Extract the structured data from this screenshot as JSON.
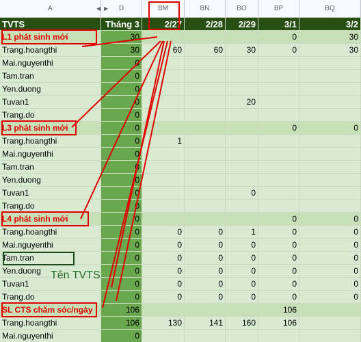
{
  "col_headers": [
    "A",
    "D",
    "BM",
    "BN",
    "BO",
    "BP",
    "BQ"
  ],
  "header_row": [
    "TVTS",
    "Tháng 3",
    "2/27",
    "2/28",
    "2/29",
    "3/1",
    "3/2"
  ],
  "rows": [
    {
      "type": "section",
      "cells": [
        "L1 phát sinh mới",
        "30",
        "",
        "",
        "",
        "0",
        "30"
      ]
    },
    {
      "type": "row",
      "cells": [
        "Trang.hoangthi",
        "30",
        "60",
        "60",
        "30",
        "0",
        "30"
      ]
    },
    {
      "type": "row",
      "cells": [
        "Mai.nguyenthi",
        "0",
        "",
        "",
        "",
        "",
        ""
      ]
    },
    {
      "type": "row",
      "cells": [
        "Tam.tran",
        "0",
        "",
        "",
        "",
        "",
        ""
      ]
    },
    {
      "type": "row",
      "cells": [
        "Yen.duong",
        "0",
        "",
        "",
        "",
        "",
        ""
      ]
    },
    {
      "type": "row",
      "cells": [
        "Tuvan1",
        "0",
        "",
        "",
        "20",
        "",
        ""
      ]
    },
    {
      "type": "row",
      "cells": [
        "Trang.do",
        "0",
        "",
        "",
        "",
        "",
        ""
      ]
    },
    {
      "type": "section",
      "cells": [
        "L3 phát sinh mới",
        "0",
        "",
        "",
        "",
        "0",
        "0"
      ]
    },
    {
      "type": "row",
      "cells": [
        "Trang.hoangthi",
        "0",
        "1",
        "",
        "",
        "",
        ""
      ]
    },
    {
      "type": "row",
      "cells": [
        "Mai.nguyenthi",
        "0",
        "",
        "",
        "",
        "",
        ""
      ]
    },
    {
      "type": "row",
      "cells": [
        "Tam.tran",
        "0",
        "",
        "",
        "",
        "",
        ""
      ]
    },
    {
      "type": "row",
      "cells": [
        "Yen.duong",
        "0",
        "",
        "",
        "",
        "",
        ""
      ]
    },
    {
      "type": "row",
      "cells": [
        "Tuvan1",
        "0",
        "",
        "",
        "0",
        "",
        ""
      ]
    },
    {
      "type": "row",
      "cells": [
        "Trang.do",
        "0",
        "",
        "",
        "",
        "",
        ""
      ]
    },
    {
      "type": "section",
      "cells": [
        "L4 phát sinh mới",
        "0",
        "",
        "",
        "",
        "0",
        "0"
      ]
    },
    {
      "type": "row",
      "cells": [
        "Trang.hoangthi",
        "0",
        "0",
        "0",
        "1",
        "0",
        "0"
      ]
    },
    {
      "type": "row",
      "cells": [
        "Mai.nguyenthi",
        "0",
        "0",
        "0",
        "0",
        "0",
        "0"
      ]
    },
    {
      "type": "row",
      "cells": [
        "Tam.tran",
        "0",
        "0",
        "0",
        "0",
        "0",
        "0"
      ]
    },
    {
      "type": "row",
      "cells": [
        "Yen.duong",
        "0",
        "0",
        "0",
        "0",
        "0",
        "0"
      ]
    },
    {
      "type": "row",
      "cells": [
        "Tuvan1",
        "0",
        "0",
        "0",
        "0",
        "0",
        "0"
      ]
    },
    {
      "type": "row",
      "cells": [
        "Trang.do",
        "0",
        "0",
        "0",
        "0",
        "0",
        "0"
      ]
    },
    {
      "type": "section",
      "cells": [
        "SL CTS chăm sóc/ngày",
        "106",
        "",
        "",
        "",
        "106",
        ""
      ]
    },
    {
      "type": "row",
      "cells": [
        "Trang.hoangthi",
        "106",
        "130",
        "141",
        "160",
        "106",
        ""
      ]
    },
    {
      "type": "row",
      "cells": [
        "Mai.nguyenthi",
        "0",
        "",
        "",
        "",
        "",
        ""
      ]
    }
  ],
  "annotation_text": "Tên TVTS",
  "colors": {
    "header_dark_green": "#274e13",
    "month_column_green": "#6aa84f",
    "light_green": "#d9ead3",
    "section_green": "#c7e0b8",
    "annotation_red": "#e00000",
    "annotation_text_green": "#1f6a26"
  }
}
